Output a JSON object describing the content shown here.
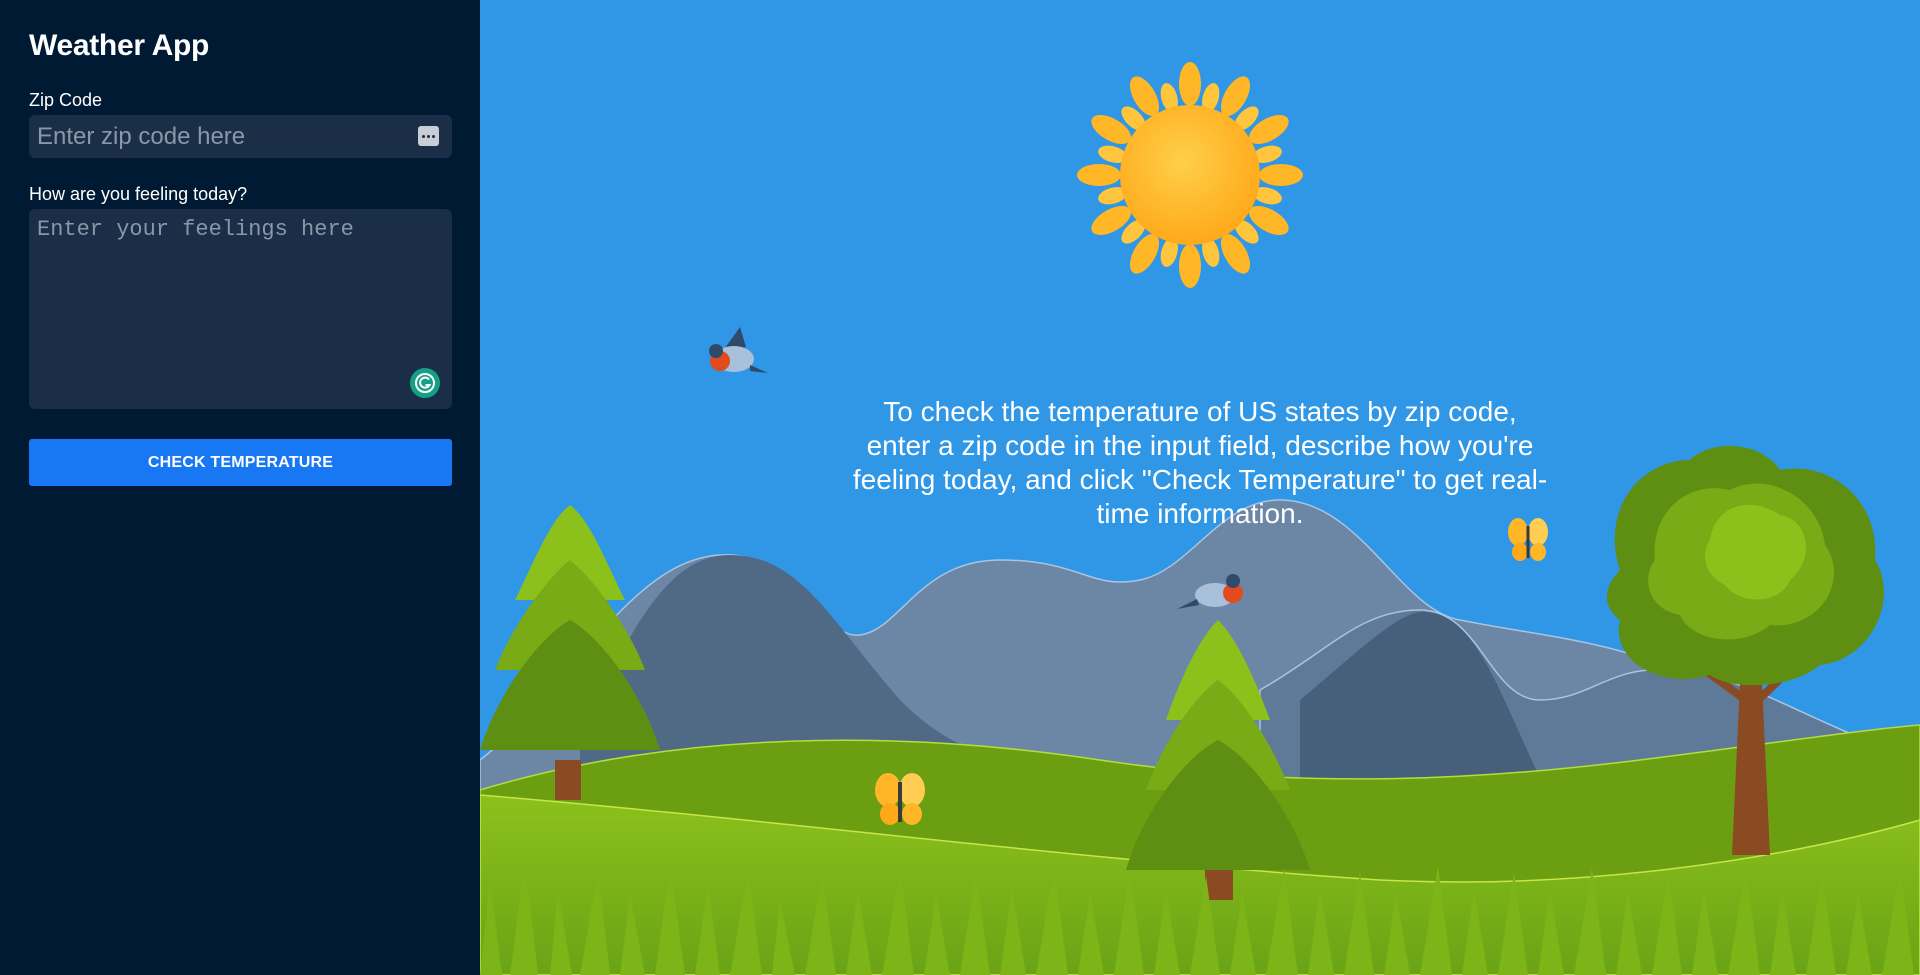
{
  "app": {
    "title": "Weather App"
  },
  "form": {
    "zip_label": "Zip Code",
    "zip_placeholder": "Enter zip code here",
    "zip_value": "",
    "feelings_label": "How are you feeling today?",
    "feelings_placeholder": "Enter your feelings here",
    "feelings_value": "",
    "submit_label": "CHECK TEMPERATURE"
  },
  "main": {
    "instructions": "To check the temperature of US states by zip code, enter a zip code in the input field, describe how you're feeling today, and click \"Check Temperature\" to get real-time information."
  },
  "icons": {
    "zip_field_icon": "password-manager-icon",
    "feelings_field_icon": "grammarly-icon"
  },
  "colors": {
    "sidebar_bg": "#001a33",
    "input_bg": "#1a2e47",
    "button_bg": "#1877f2",
    "sky": "#3096e6",
    "sun": "#ffb627"
  }
}
